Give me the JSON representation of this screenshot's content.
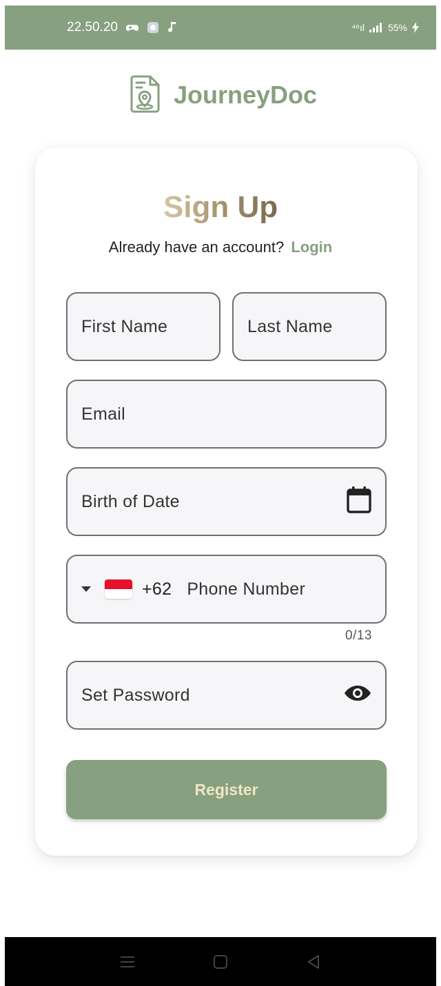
{
  "status_bar": {
    "time": "22.50.20",
    "network": "⁴⁶ıl",
    "signal": "..ıl",
    "battery": "55%"
  },
  "brand": {
    "name": "JourneyDoc",
    "logo_icon": "document-location-icon"
  },
  "signup": {
    "title": "Sign Up",
    "account_prompt": "Already have an account?",
    "login_link": "Login"
  },
  "form": {
    "first_name_placeholder": "First Name",
    "last_name_placeholder": "Last Name",
    "email_placeholder": "Email",
    "birth_placeholder": "Birth of Date",
    "phone": {
      "dial_code": "+62",
      "placeholder": "Phone Number",
      "counter": "0/13",
      "country_flag": "indonesia-flag-icon"
    },
    "password_placeholder": "Set Password",
    "register_label": "Register"
  },
  "colors": {
    "accent": "#87a07f",
    "title_gradient": [
      "#d6c6a4",
      "#7a6a52"
    ],
    "register_text": "#efe6c6",
    "field_bg": "#f6f6f9"
  },
  "nav_bar": {
    "buttons": [
      "menu-icon",
      "home-icon",
      "back-icon"
    ]
  }
}
